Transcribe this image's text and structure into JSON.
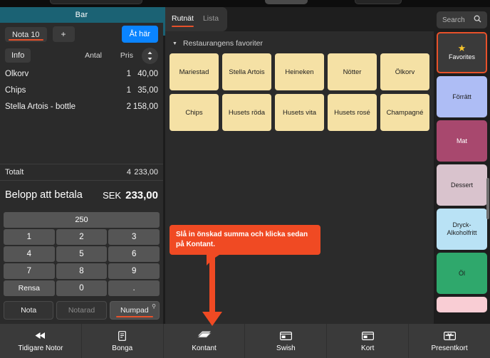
{
  "left_panel": {
    "header_title": "Bar",
    "nota_tab": "Nota 10",
    "add_tab": "+",
    "dine_in_button": "Åt här",
    "info_button": "Info",
    "col_qty": "Antal",
    "col_price": "Pris",
    "sort_icon": "sort-updown-icon",
    "items": [
      {
        "name": "Ölkorv",
        "qty": "1",
        "price": "40,00"
      },
      {
        "name": "Chips",
        "qty": "1",
        "price": "35,00"
      },
      {
        "name": "Stella Artois - bottle",
        "qty": "2",
        "price": "158,00"
      }
    ],
    "total": {
      "label": "Totalt",
      "qty": "4",
      "sum": "233,00"
    },
    "payable": {
      "label": "Belopp att betala",
      "currency": "SEK",
      "value": "233,00"
    },
    "numpad": {
      "amount_value": "250",
      "keys": [
        "1",
        "2",
        "3",
        "4",
        "5",
        "6",
        "7",
        "8",
        "9",
        "Rensa",
        "0",
        "."
      ]
    },
    "mode_tabs": [
      {
        "label": "Nota",
        "state": "idle"
      },
      {
        "label": "Notarad",
        "state": "dim"
      },
      {
        "label": "Numpad",
        "state": "active"
      }
    ]
  },
  "center": {
    "view_tabs": [
      {
        "label": "Rutnät",
        "active": true
      },
      {
        "label": "Lista",
        "active": false
      }
    ],
    "group_title": "Restaurangens favoriter",
    "group_caret": "caret-down-icon",
    "products": [
      "Mariestad",
      "Stella Artois",
      "Heineken",
      "Nötter",
      "Ölkorv",
      "Chips",
      "Husets röda",
      "Husets vita",
      "Husets rosé",
      "Champagné"
    ]
  },
  "right_rail": {
    "search_placeholder": "Search",
    "search_icon": "search-icon",
    "categories": [
      {
        "label": "Favorites",
        "color": "#3a3a3a",
        "selected": true,
        "icon": "star-icon"
      },
      {
        "label": "Förrätt",
        "color": "#aebdf5",
        "selected": false
      },
      {
        "label": "Mat",
        "color": "#a8486e",
        "selected": false
      },
      {
        "label": "Dessert",
        "color": "#d9c3cd",
        "selected": false
      },
      {
        "label": "Dryck-\nAlkoholfritt",
        "color": "#b9e2f5",
        "selected": false
      },
      {
        "label": "Öl",
        "color": "#2fa86c",
        "selected": false
      },
      {
        "label": "",
        "color": "#f9cdd4",
        "selected": false
      }
    ]
  },
  "bottom_bar": {
    "items": [
      {
        "label": "Tidigare Notor",
        "icon": "rewind-icon"
      },
      {
        "label": "Bonga",
        "icon": "receipt-icon"
      },
      {
        "label": "Kontant",
        "icon": "cash-stack-icon"
      },
      {
        "label": "Swish",
        "icon": "card-icon"
      },
      {
        "label": "Kort",
        "icon": "card-icon"
      },
      {
        "label": "Presentkort",
        "icon": "gift-card-icon"
      }
    ]
  },
  "callout": {
    "text": "Slå in önskad summa och klicka sedan på Kontant.",
    "color": "#f04a23"
  }
}
